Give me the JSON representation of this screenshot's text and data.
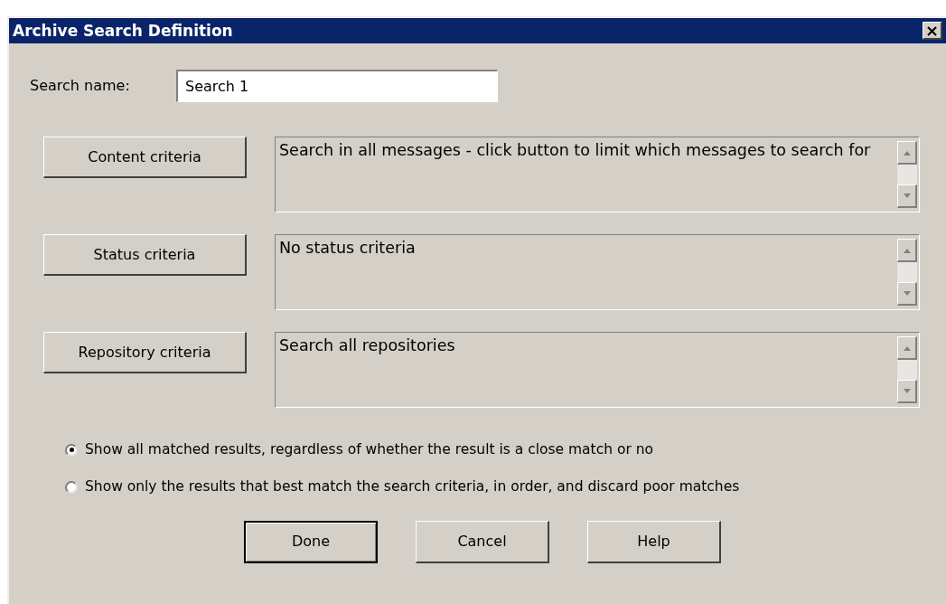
{
  "window": {
    "title": "Archive Search Definition",
    "close": "×"
  },
  "search_name": {
    "label": "Search name:",
    "value": "Search 1"
  },
  "criteria": [
    {
      "button": "Content criteria",
      "summary": "Search in all messages - click button to limit which messages to search for"
    },
    {
      "button": "Status criteria",
      "summary": "No status criteria"
    },
    {
      "button": "Repository criteria",
      "summary": "Search all repositories"
    }
  ],
  "result_options": [
    {
      "label": "Show all matched results, regardless of whether the result is a close match or no",
      "selected": true
    },
    {
      "label": "Show only the results that best match the search criteria, in order, and discard poor matches",
      "selected": false
    }
  ],
  "buttons": [
    {
      "label": "Done",
      "default": true
    },
    {
      "label": "Cancel",
      "default": false
    },
    {
      "label": "Help",
      "default": false
    }
  ]
}
